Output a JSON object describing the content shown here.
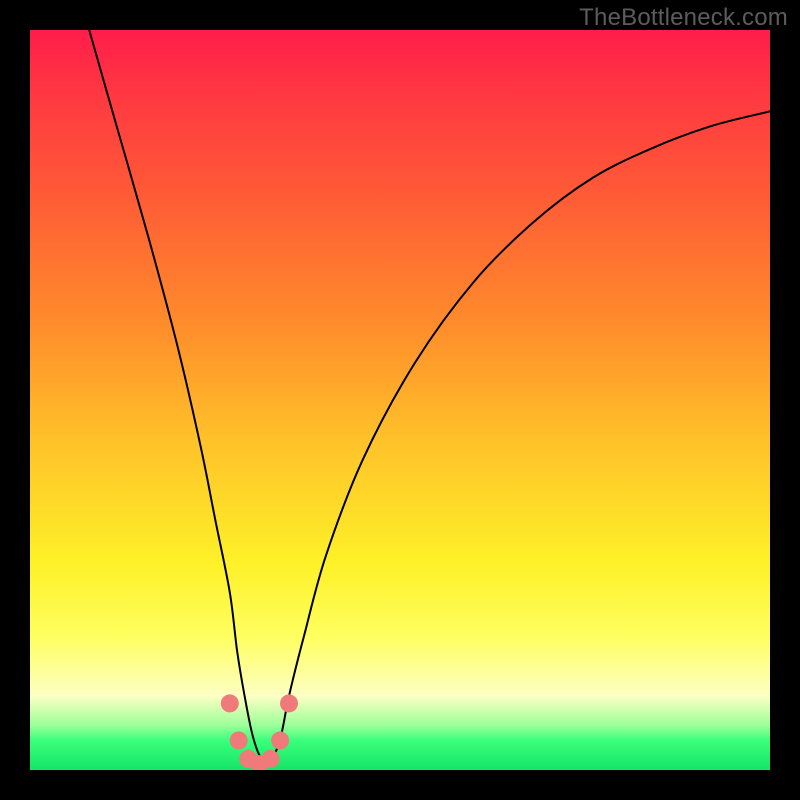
{
  "watermark": "TheBottleneck.com",
  "chart_data": {
    "type": "line",
    "title": "",
    "xlabel": "",
    "ylabel": "",
    "ylim": [
      0,
      100
    ],
    "xlim": [
      0,
      100
    ],
    "series": [
      {
        "name": "curve",
        "x": [
          8,
          12,
          16,
          20,
          23,
          25,
          27,
          28,
          29,
          30,
          31,
          32,
          33,
          34,
          35,
          37,
          40,
          45,
          52,
          60,
          68,
          76,
          84,
          92,
          100
        ],
        "y": [
          100,
          86,
          72,
          57,
          44,
          34,
          24,
          16,
          10,
          5,
          2,
          1,
          2,
          5,
          10,
          18,
          29,
          42,
          55,
          66,
          74,
          80,
          84,
          87,
          89
        ]
      }
    ],
    "markers": {
      "name": "dots-near-minimum",
      "x": [
        27.0,
        28.2,
        29.5,
        31.0,
        32.5,
        33.8,
        35.0
      ],
      "y": [
        9.0,
        4.0,
        1.5,
        0.8,
        1.5,
        4.0,
        9.0
      ]
    },
    "gradient_colors": {
      "top": "#ff1d4a",
      "mid1": "#ff8d2b",
      "mid2": "#fef128",
      "bottom": "#15e468"
    }
  }
}
